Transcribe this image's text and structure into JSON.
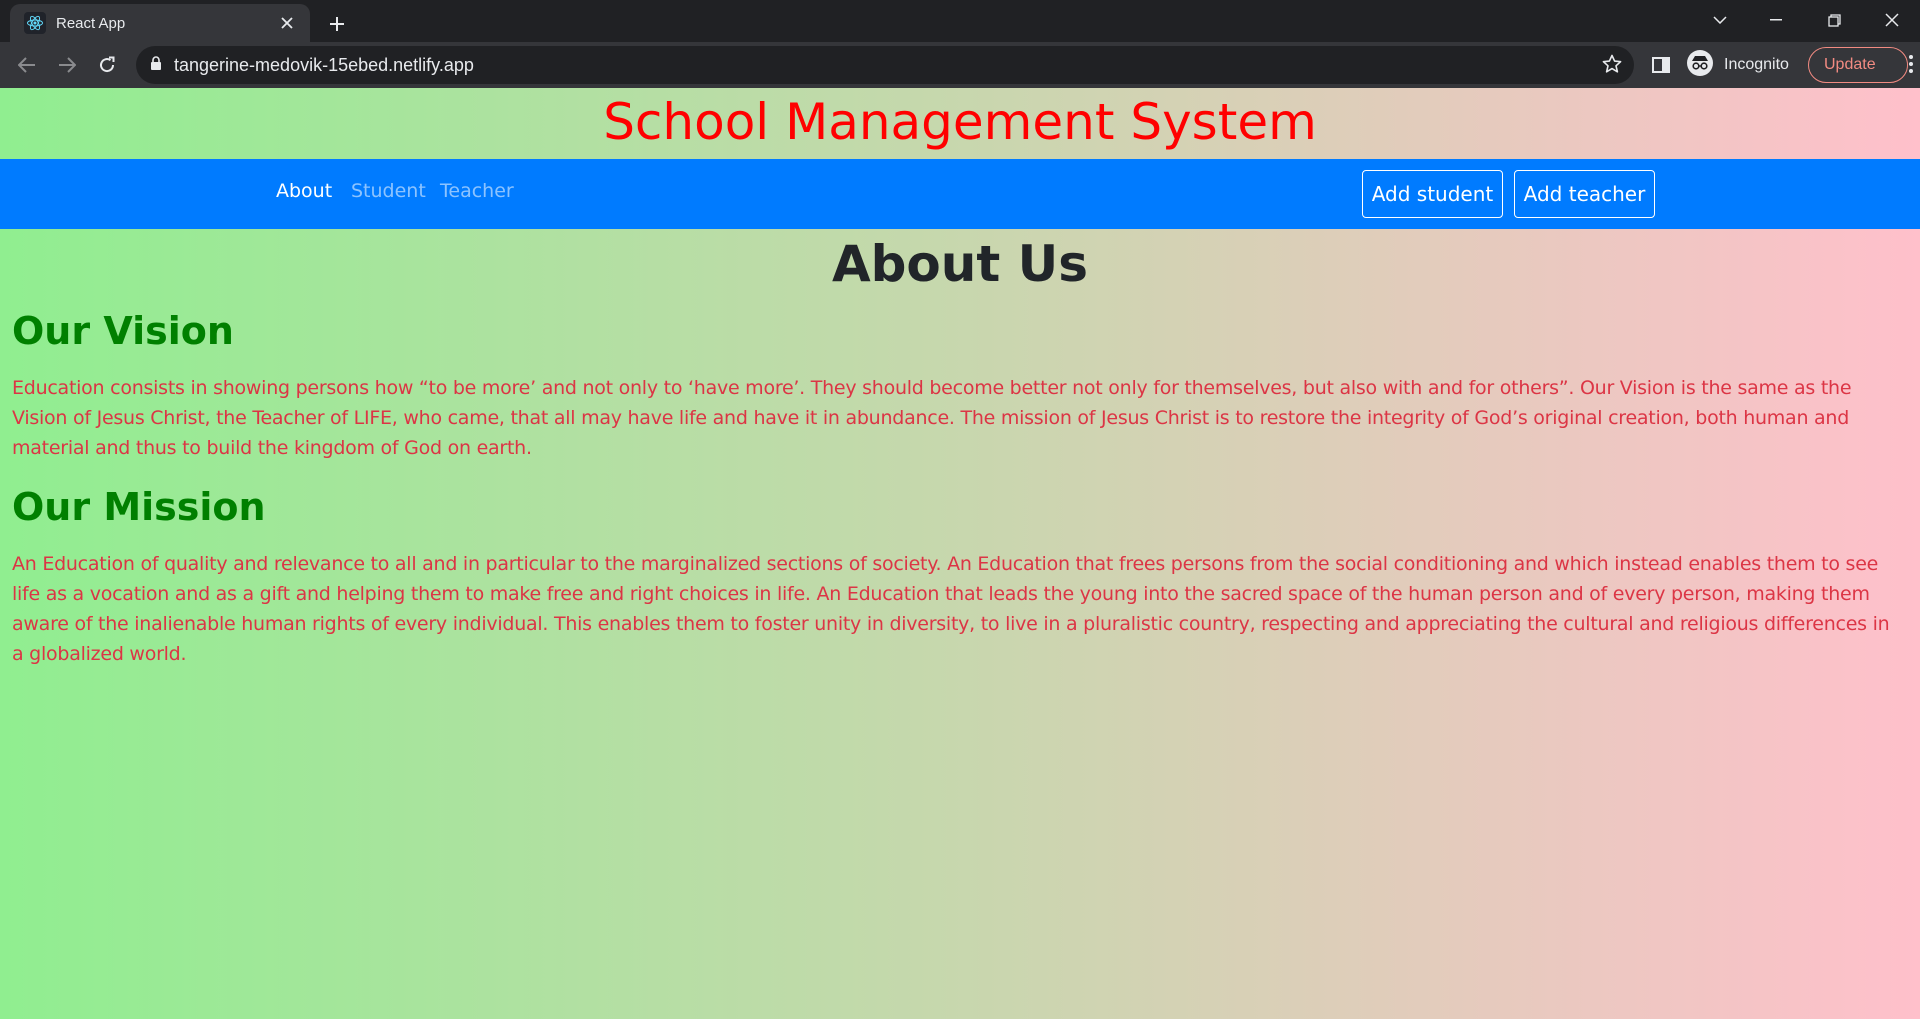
{
  "browser": {
    "tab_title": "React App",
    "url": "tangerine-medovik-15ebed.netlify.app",
    "profile_label": "Incognito",
    "update_label": "Update",
    "icons": [
      "react-favicon",
      "close-icon",
      "plus-icon",
      "chevron-down-icon",
      "minimize-icon",
      "restore-icon",
      "window-close-icon",
      "back-icon",
      "forward-icon",
      "reload-icon",
      "lock-icon",
      "star-icon",
      "side-panel-icon",
      "incognito-icon",
      "kebab-menu-icon"
    ]
  },
  "site": {
    "title": "School Management System",
    "title_color": "#ff0000"
  },
  "navbar": {
    "bg_color": "#007bff",
    "links": [
      {
        "label": "About",
        "active": true
      },
      {
        "label": "Student",
        "active": false
      },
      {
        "label": "Teacher",
        "active": false
      }
    ],
    "buttons": [
      {
        "label": "Add student"
      },
      {
        "label": "Add teacher"
      }
    ]
  },
  "main": {
    "heading": "About Us",
    "sections": [
      {
        "title": "Our Vision",
        "text": "Education consists in showing persons how “to be more’ and not only to ‘have more’. They should become better not only for themselves, but also with and for others”. Our Vision is the same as the Vision of Jesus Christ, the Teacher of LIFE, who came, that all may have life and have it in abundance. The mission of Jesus Christ is to restore the integrity of God’s original creation, both human and material and thus to build the kingdom of God on earth."
      },
      {
        "title": "Our Mission",
        "text": "An Education of quality and relevance to all and in particular to the marginalized sections of society. An Education that frees persons from the social conditioning and which instead enables them to see life as a vocation and as a gift and helping them to make free and right choices in life. An Education that leads the young into the sacred space of the human person and of every person, making them aware of the inalienable human rights of every individual. This enables them to foster unity in diversity, to live in a pluralistic country, respecting and appreciating the cultural and religious differences in a globalized world."
      }
    ],
    "gradient": [
      "#90ee90",
      "#ffc0cb"
    ],
    "heading_color": "#008000",
    "text_color": "#dc3545"
  }
}
